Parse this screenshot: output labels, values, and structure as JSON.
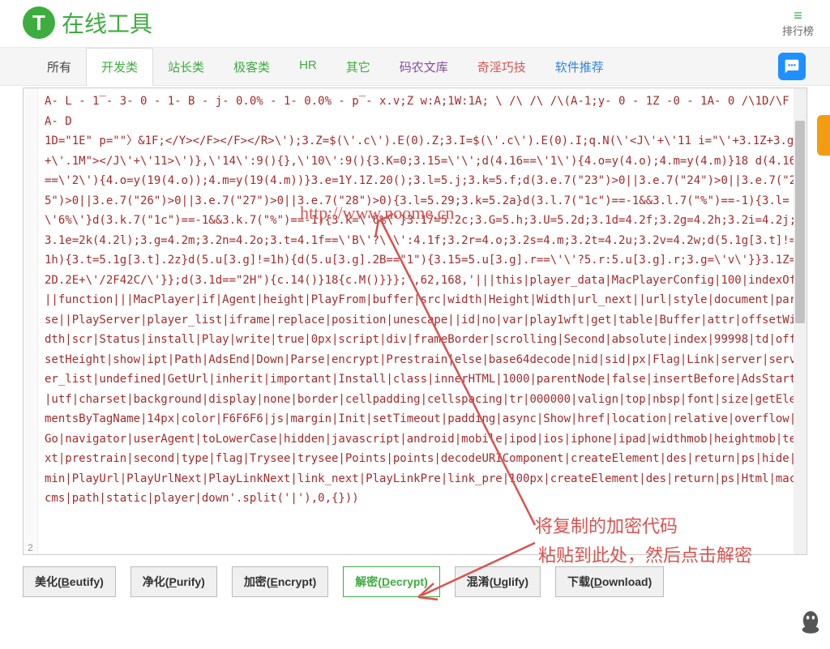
{
  "header": {
    "logo_letter": "T",
    "logo_text": "在线工具",
    "rank_label": "排行榜"
  },
  "nav": {
    "items": [
      {
        "label": "所有",
        "cls": ""
      },
      {
        "label": "开发类",
        "cls": "active"
      },
      {
        "label": "站长类",
        "cls": "green"
      },
      {
        "label": "极客类",
        "cls": "green"
      },
      {
        "label": "HR",
        "cls": "green"
      },
      {
        "label": "其它",
        "cls": "green"
      },
      {
        "label": "码农文库",
        "cls": "purple"
      },
      {
        "label": "奇淫巧技",
        "cls": "red"
      },
      {
        "label": "软件推荐",
        "cls": "blue"
      }
    ]
  },
  "editor": {
    "line_number": "2",
    "code": "A- L - 1‾- 3- 0 - 1- B - j- 0.0% - 1- 0.0% - p‾- x.v;Z w:A;1W:1A; \\ /\\ /\\ /\\(A-1;y- 0 - 1Z -0 - 1A- 0 /\\1D/\\F A- D\n1D=\"1E\" p=\"\"〉&1F;</Y></F></F></R>\\');3.Z=$(\\'.c\\').E(0).Z;3.I=$(\\'.c\\').E(0).I;q.N(\\'<J\\'+\\'11 i=\"\\'+3.1Z+3.g+\\'.1M\"></J\\'+\\'11>\\')},\\'14\\':9(){},\\'10\\':9(){3.K=0;3.15=\\'\\';d(4.16==\\'1\\'){4.o=y(4.o);4.m=y(4.m)}18 d(4.16==\\'2\\'){4.o=y(19(4.o));4.m=y(19(4.m))}3.e=1Y.1Z.20();3.l=5.j;3.k=5.f;d(3.e.7(\"23\")>0||3.e.7(\"24\")>0||3.e.7(\"25\")>0||3.e.7(\"26\")>0||3.e.7(\"27\")>0||3.e.7(\"28\")>0){3.l=5.29;3.k=5.2a}d(3.l.7(\"1c\")==-1&&3.l.7(\"%\")==-1){3.l=\\'6%\\'}d(3.k.7(\"1c\")==-1&&3.k.7(\"%\")==-1){3.k=\\'6%\\'}3.17=5.2c;3.G=5.h;3.U=5.2d;3.1d=4.2f;3.2g=4.2h;3.2i=4.2j;3.1e=2k(4.2l);3.g=4.2m;3.2n=4.2o;3.t=4.1f==\\'B\\'?\\'\\':4.1f;3.2r=4.o;3.2s=4.m;3.2t=4.2u;3.2v=4.2w;d(5.1g[3.t]!=1h){3.t=5.1g[3.t].2z}d(5.u[3.g]!=1h){d(5.u[3.g].2B==\"1\"){3.15=5.u[3.g].r==\\'\\'?5.r:5.u[3.g].r;3.g=\\'v\\'}}3.1Z=2D.2E+\\'/2F42C/\\'}};d(3.1d==\"2H\"){c.14()}18{c.M()}}};',62,168,'|||this|player_data|MacPlayerConfig|100|indexOf||function|||MacPlayer|if|Agent|height|PlayFrom|buffer|src|width|Height|Width|url_next||url|style|document|parse||PlayServer|player_list|iframe|replace|position|unescape||id|no|var|play1wft|get|table|Buffer|attr|offsetWidth|scr|Status|install|Play|write|true|0px|script|div|frameBorder|scrolling|Second|absolute|index|99998|td|offsetHeight|show|ipt|Path|AdsEnd|Down|Parse|encrypt|Prestrain|else|base64decode|nid|sid|px|Flag|Link|server|server_list|undefined|GetUrl|inherit|important|Install|class|innerHTML|1000|parentNode|false|insertBefore|AdsStart|utf|charset|background|display|none|border|cellpadding|cellspacing|tr|000000|valign|top|nbsp|font|size|getElementsByTagName|14px|color|F6F6F6|js|margin|Init|setTimeout|padding|async|Show|href|location|relative|overflow|Go|navigator|userAgent|toLowerCase|hidden|javascript|android|mobile|ipod|ios|iphone|ipad|widthmob|heightmob|text|prestrain|second|type|flag|Trysee|trysee|Points|points|decodeURIComponent|createElement|des|return|ps|hide|min|PlayUrl|PlayUrlNext|PlayLinkNext|link_next|PlayLinkPre|link_pre|100px|createElement|des|return|ps|Html|maccms|path|static|player|down'.split('|'),0,{}))"
  },
  "watermark": "http://www.noome.cn",
  "annotations": {
    "line1": "将复制的加密代码",
    "line2": "粘贴到此处，然后点击解密"
  },
  "buttons": {
    "beautify": {
      "zh": "美化(",
      "u": "B",
      "rest": "eutify)"
    },
    "purify": {
      "zh": "净化(",
      "u": "P",
      "rest": "urify)"
    },
    "encrypt": {
      "zh": "加密(",
      "u": "E",
      "rest": "ncrypt)"
    },
    "decrypt": {
      "zh": "解密(",
      "u": "D",
      "rest": "ecrypt)"
    },
    "uglify": {
      "zh": "混淆(",
      "u": "U",
      "rest": "glify)"
    },
    "download": {
      "zh": "下载(",
      "u": "D",
      "rest": "ownload)"
    }
  }
}
